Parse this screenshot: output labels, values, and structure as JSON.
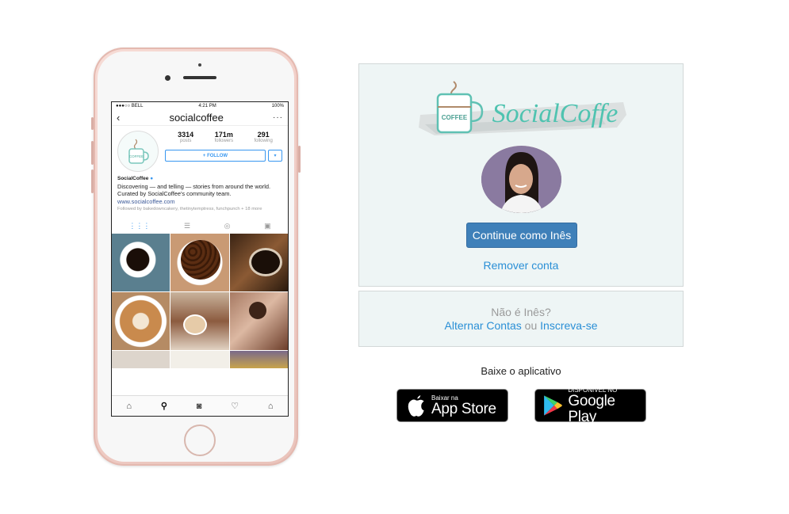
{
  "phone": {
    "status": {
      "carrier": "●●●○○ BELL",
      "time": "4:21 PM",
      "battery": "100%"
    },
    "header": {
      "back": "‹",
      "username": "socialcoffee",
      "more": "···"
    },
    "profile": {
      "stats": [
        {
          "num": "3314",
          "label": "posts"
        },
        {
          "num": "171m",
          "label": "followers"
        },
        {
          "num": "291",
          "label": "following"
        }
      ],
      "follow_label": "+ FOLLOW",
      "dropdown": "▾",
      "avatar_text": "COFFEE"
    },
    "bio": {
      "name": "SocialCoffee",
      "text": "Discovering — and telling — stories from around the world. Curated by SocialCoffee's community team.",
      "link": "www.socialcoffee.com",
      "followed_by": "Followed by bakedowncakery, thetinytemptress, funchpunch + 18 more"
    }
  },
  "logo": {
    "text": "SocialCoffe",
    "cup_text": "COFFEE"
  },
  "account": {
    "continue_label": "Continue como Inês",
    "remove_label": "Remover conta"
  },
  "switch": {
    "not_you": "Não é Inês?",
    "switch_label": "Alternar Contas",
    "or": "ou",
    "signup_label": "Inscreva-se"
  },
  "get_app": "Baixe o aplicativo",
  "stores": {
    "apple": {
      "small": "Baixar na",
      "big": "App Store"
    },
    "google": {
      "small": "DISPONÍVEL NO",
      "big": "Google Play"
    }
  },
  "colors": {
    "accent": "#3f80b9",
    "link": "#2a8fd6",
    "card_bg": "#eef5f5",
    "logo_teal": "#4fc3b0"
  }
}
